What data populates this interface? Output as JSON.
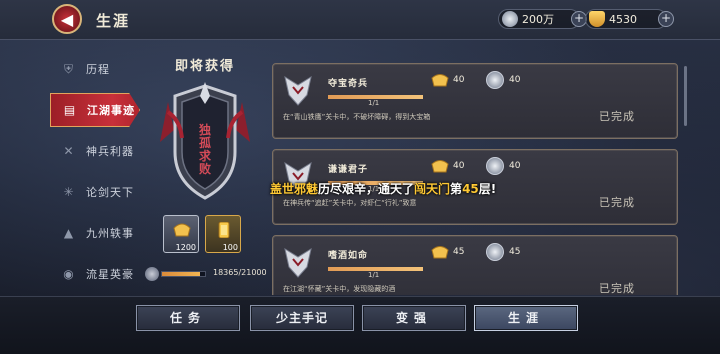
{
  "header": {
    "title": "生涯",
    "silver_amount": "200万",
    "gold_amount": "4530",
    "add_symbol": "+"
  },
  "sidebar": {
    "items": [
      {
        "label": "历程",
        "icon": "shield-icon"
      },
      {
        "label": "江湖事迹",
        "icon": "scroll-icon"
      },
      {
        "label": "神兵利器",
        "icon": "crossed-swords-icon"
      },
      {
        "label": "论剑天下",
        "icon": "star-burst-icon"
      },
      {
        "label": "九州轶事",
        "icon": "mountain-icon"
      },
      {
        "label": "流星英豪",
        "icon": "helmet-icon"
      }
    ],
    "active_index": 1
  },
  "reward": {
    "title": "即将获得",
    "emblem_text": "独孤求败",
    "items": [
      {
        "qty": "1200",
        "kind": "gold-ingot"
      },
      {
        "qty": "100",
        "kind": "gold-scroll"
      }
    ],
    "progress_text": "18365/21000",
    "progress_fraction": 0.874
  },
  "tasks": [
    {
      "title": "夺宝奇兵",
      "progress": "1/1",
      "desc": "在“青山铁鹰”关卡中，不破坏障碍，得到大宝箱",
      "gold": "40",
      "silver": "40",
      "status": "已完成"
    },
    {
      "title": "谦谦君子",
      "progress": "1/1",
      "desc": "在神兵传“追赶”关卡中，对虾仁“行礼”致意",
      "gold": "40",
      "silver": "40",
      "status": "已完成"
    },
    {
      "title": "嗜酒如命",
      "progress": "1/1",
      "desc": "在江湖“怀藏”关卡中，发现隐藏的酒",
      "gold": "45",
      "silver": "45",
      "status": "已完成"
    }
  ],
  "announcement": {
    "part1": "盖世邪魅",
    "part2": "历尽艰辛，通天了",
    "part3": "闯天门",
    "part4": "第",
    "part5": "45",
    "part6": "层!"
  },
  "bottom_tabs": [
    "任务",
    "少主手记",
    "变强",
    "生涯"
  ],
  "bottom_active_index": 3,
  "colors": {
    "accent_red": "#c8303a",
    "gold": "#ffc934",
    "panel_border": "#7c6f62"
  }
}
